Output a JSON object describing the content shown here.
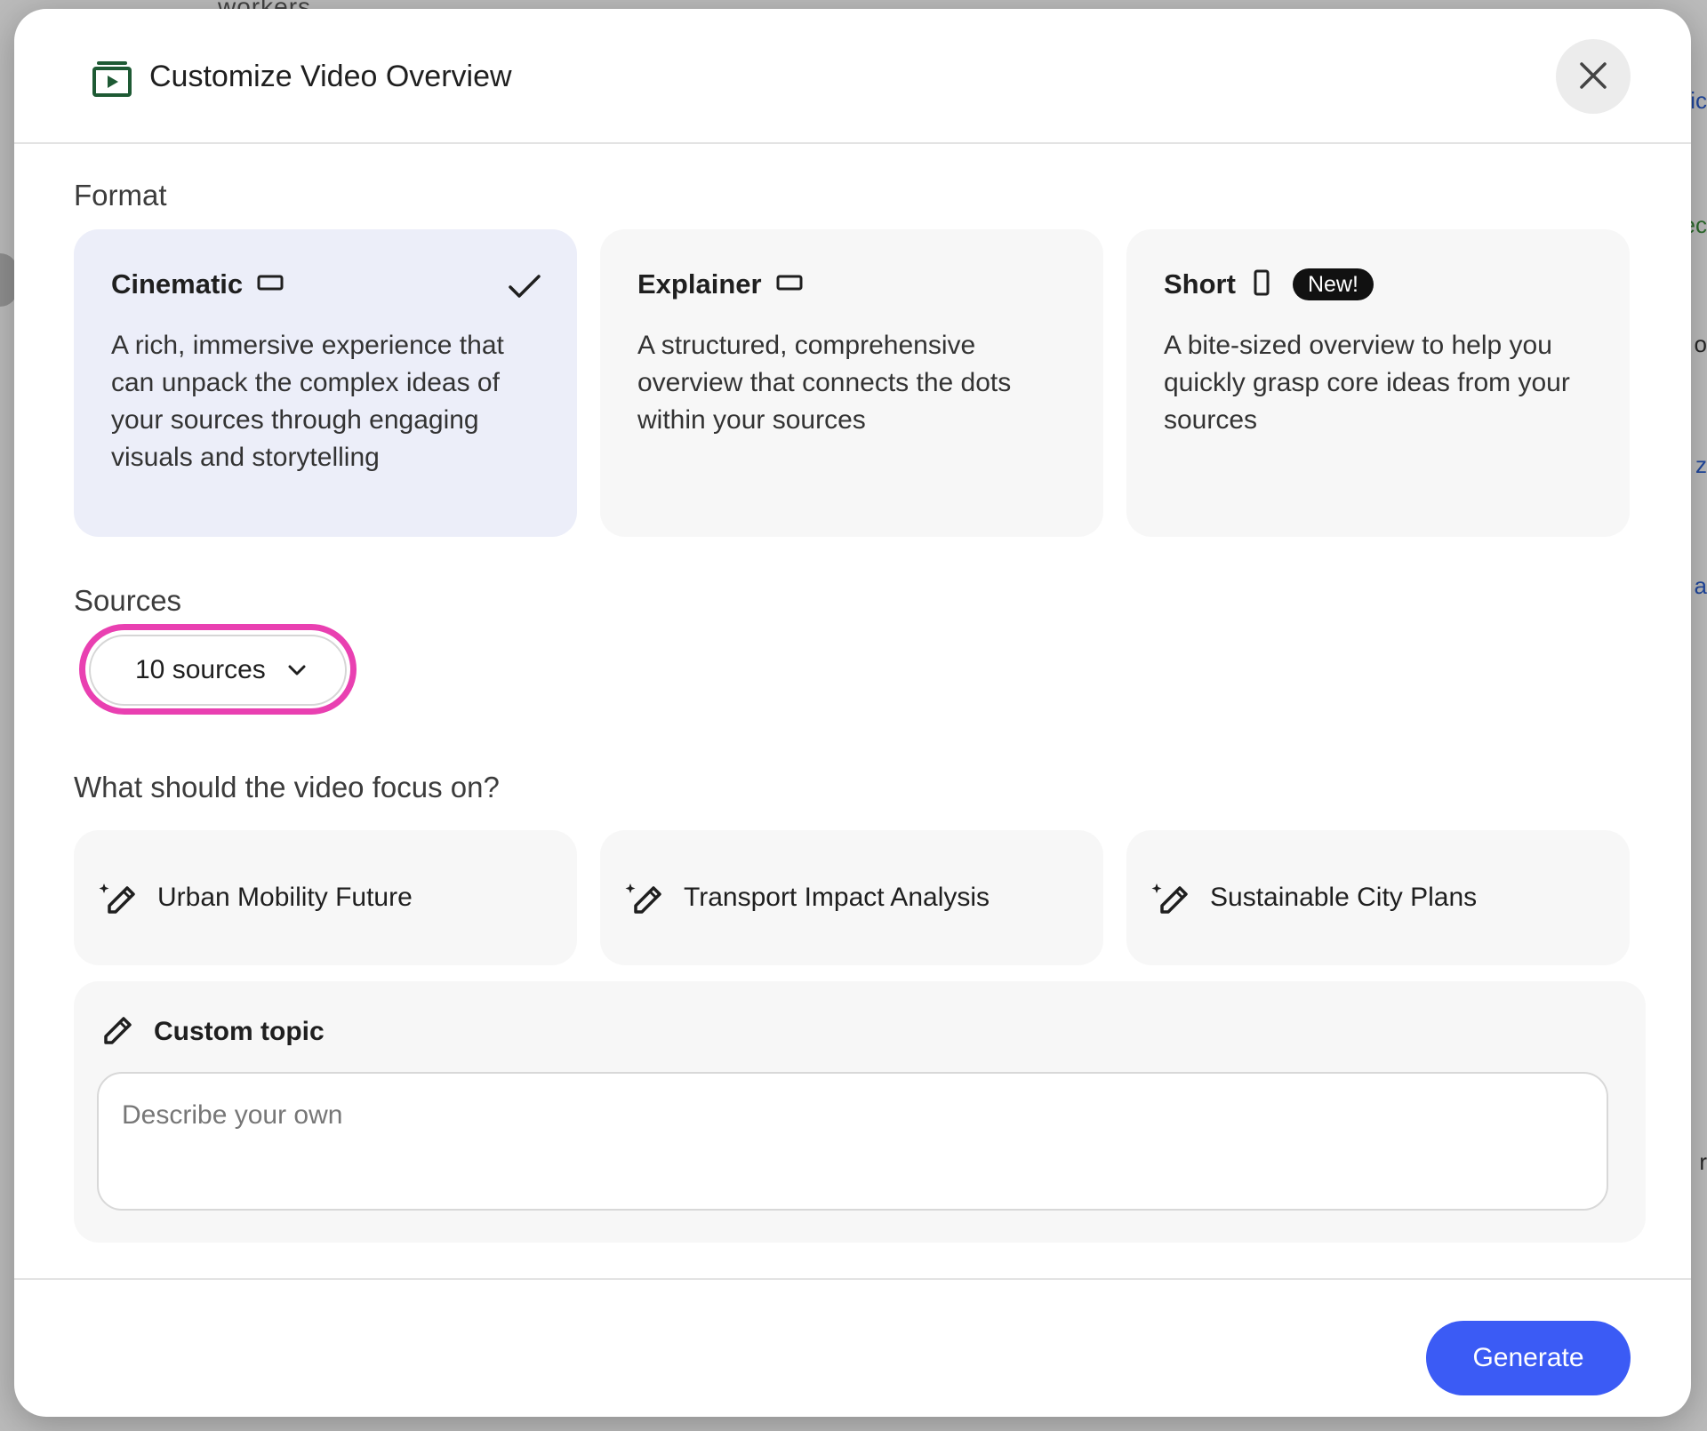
{
  "background": {
    "top_fragment": "workers",
    "right_fragments": [
      "lic",
      "ec",
      "o",
      "z",
      "a",
      "r"
    ]
  },
  "dialog": {
    "title": "Customize Video Overview",
    "header_icon": "video-overview-icon",
    "close_icon": "close-icon"
  },
  "format": {
    "label": "Format",
    "options": [
      {
        "title": "Cinematic",
        "aspect_icon": "landscape-aspect-icon",
        "description": "A rich, immersive experience that can unpack the complex ideas of your sources through engaging visuals and storytelling",
        "selected": true
      },
      {
        "title": "Explainer",
        "aspect_icon": "landscape-aspect-icon",
        "description": "A structured, comprehensive overview that connects the dots within your sources",
        "selected": false
      },
      {
        "title": "Short",
        "aspect_icon": "portrait-aspect-icon",
        "badge": "New!",
        "description": "A bite-sized overview to help you quickly grasp core ideas from your sources",
        "selected": false
      }
    ]
  },
  "sources": {
    "label": "Sources",
    "selected_value": "10 sources"
  },
  "focus": {
    "label": "What should the video focus on?",
    "suggestions": [
      {
        "label": "Urban Mobility Future",
        "icon": "magic-pencil-icon"
      },
      {
        "label": "Transport Impact Analysis",
        "icon": "magic-pencil-icon"
      },
      {
        "label": "Sustainable City Plans",
        "icon": "magic-pencil-icon"
      }
    ],
    "custom": {
      "label": "Custom topic",
      "icon": "pencil-icon",
      "value": "",
      "placeholder": "Describe your own"
    }
  },
  "footer": {
    "generate_label": "Generate"
  },
  "colors": {
    "accent": "#3b5bf5",
    "selected_card": "#eceef9",
    "highlight": "#e940b1",
    "icon_green": "#1e5a34"
  }
}
